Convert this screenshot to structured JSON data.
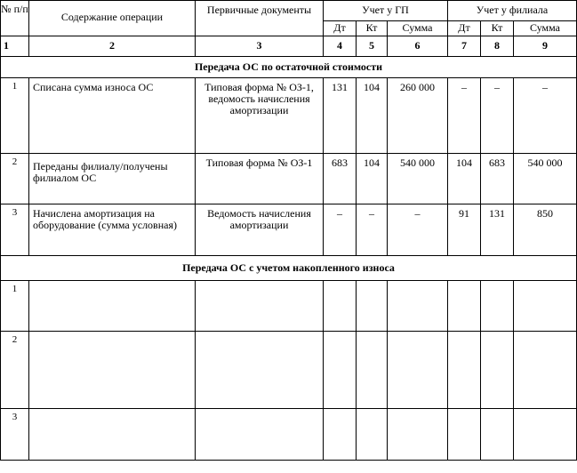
{
  "header": {
    "col_num": "№ п/п",
    "col_content": "Содержание операции",
    "col_docs": "Первичные документы",
    "group_gp": "Учет у ГП",
    "group_branch": "Учет у филиала",
    "dt": "Дт",
    "kt": "Кт",
    "sum": "Сумма"
  },
  "col_numbers": [
    "1",
    "2",
    "3",
    "4",
    "5",
    "6",
    "7",
    "8",
    "9"
  ],
  "sections": [
    {
      "title": "Передача ОС по остаточной стоимости",
      "rows": [
        {
          "n": "1",
          "content": "Списана сумма износа ОС",
          "doc": "Типовая форма № ОЗ-1, ведомость начисления амортизации",
          "gp_dt": "131",
          "gp_kt": "104",
          "gp_sum": "260 000",
          "br_dt": "–",
          "br_kt": "–",
          "br_sum": "–"
        },
        {
          "n": "2",
          "content": "Переданы филиалу/получены филиалом ОС",
          "doc": "Типовая форма № ОЗ-1",
          "gp_dt": "683",
          "gp_kt": "104",
          "gp_sum": "540 000",
          "br_dt": "104",
          "br_kt": "683",
          "br_sum": "540 000"
        },
        {
          "n": "3",
          "content": "Начислена амортизация на оборудование (сумма условная)",
          "doc": "Ведомость начисления амортизации",
          "gp_dt": "–",
          "gp_kt": "–",
          "gp_sum": "–",
          "br_dt": "91",
          "br_kt": "131",
          "br_sum": "850"
        }
      ]
    },
    {
      "title": "Передача ОС с учетом накопленного износа",
      "rows": [
        {
          "n": "1",
          "content": "",
          "doc": "",
          "gp_dt": "",
          "gp_kt": "",
          "gp_sum": "",
          "br_dt": "",
          "br_kt": "",
          "br_sum": ""
        },
        {
          "n": "2",
          "content": "",
          "doc": "",
          "gp_dt": "",
          "gp_kt": "",
          "gp_sum": "",
          "br_dt": "",
          "br_kt": "",
          "br_sum": ""
        },
        {
          "n": "3",
          "content": "",
          "doc": "",
          "gp_dt": "",
          "gp_kt": "",
          "gp_sum": "",
          "br_dt": "",
          "br_kt": "",
          "br_sum": ""
        }
      ]
    }
  ]
}
